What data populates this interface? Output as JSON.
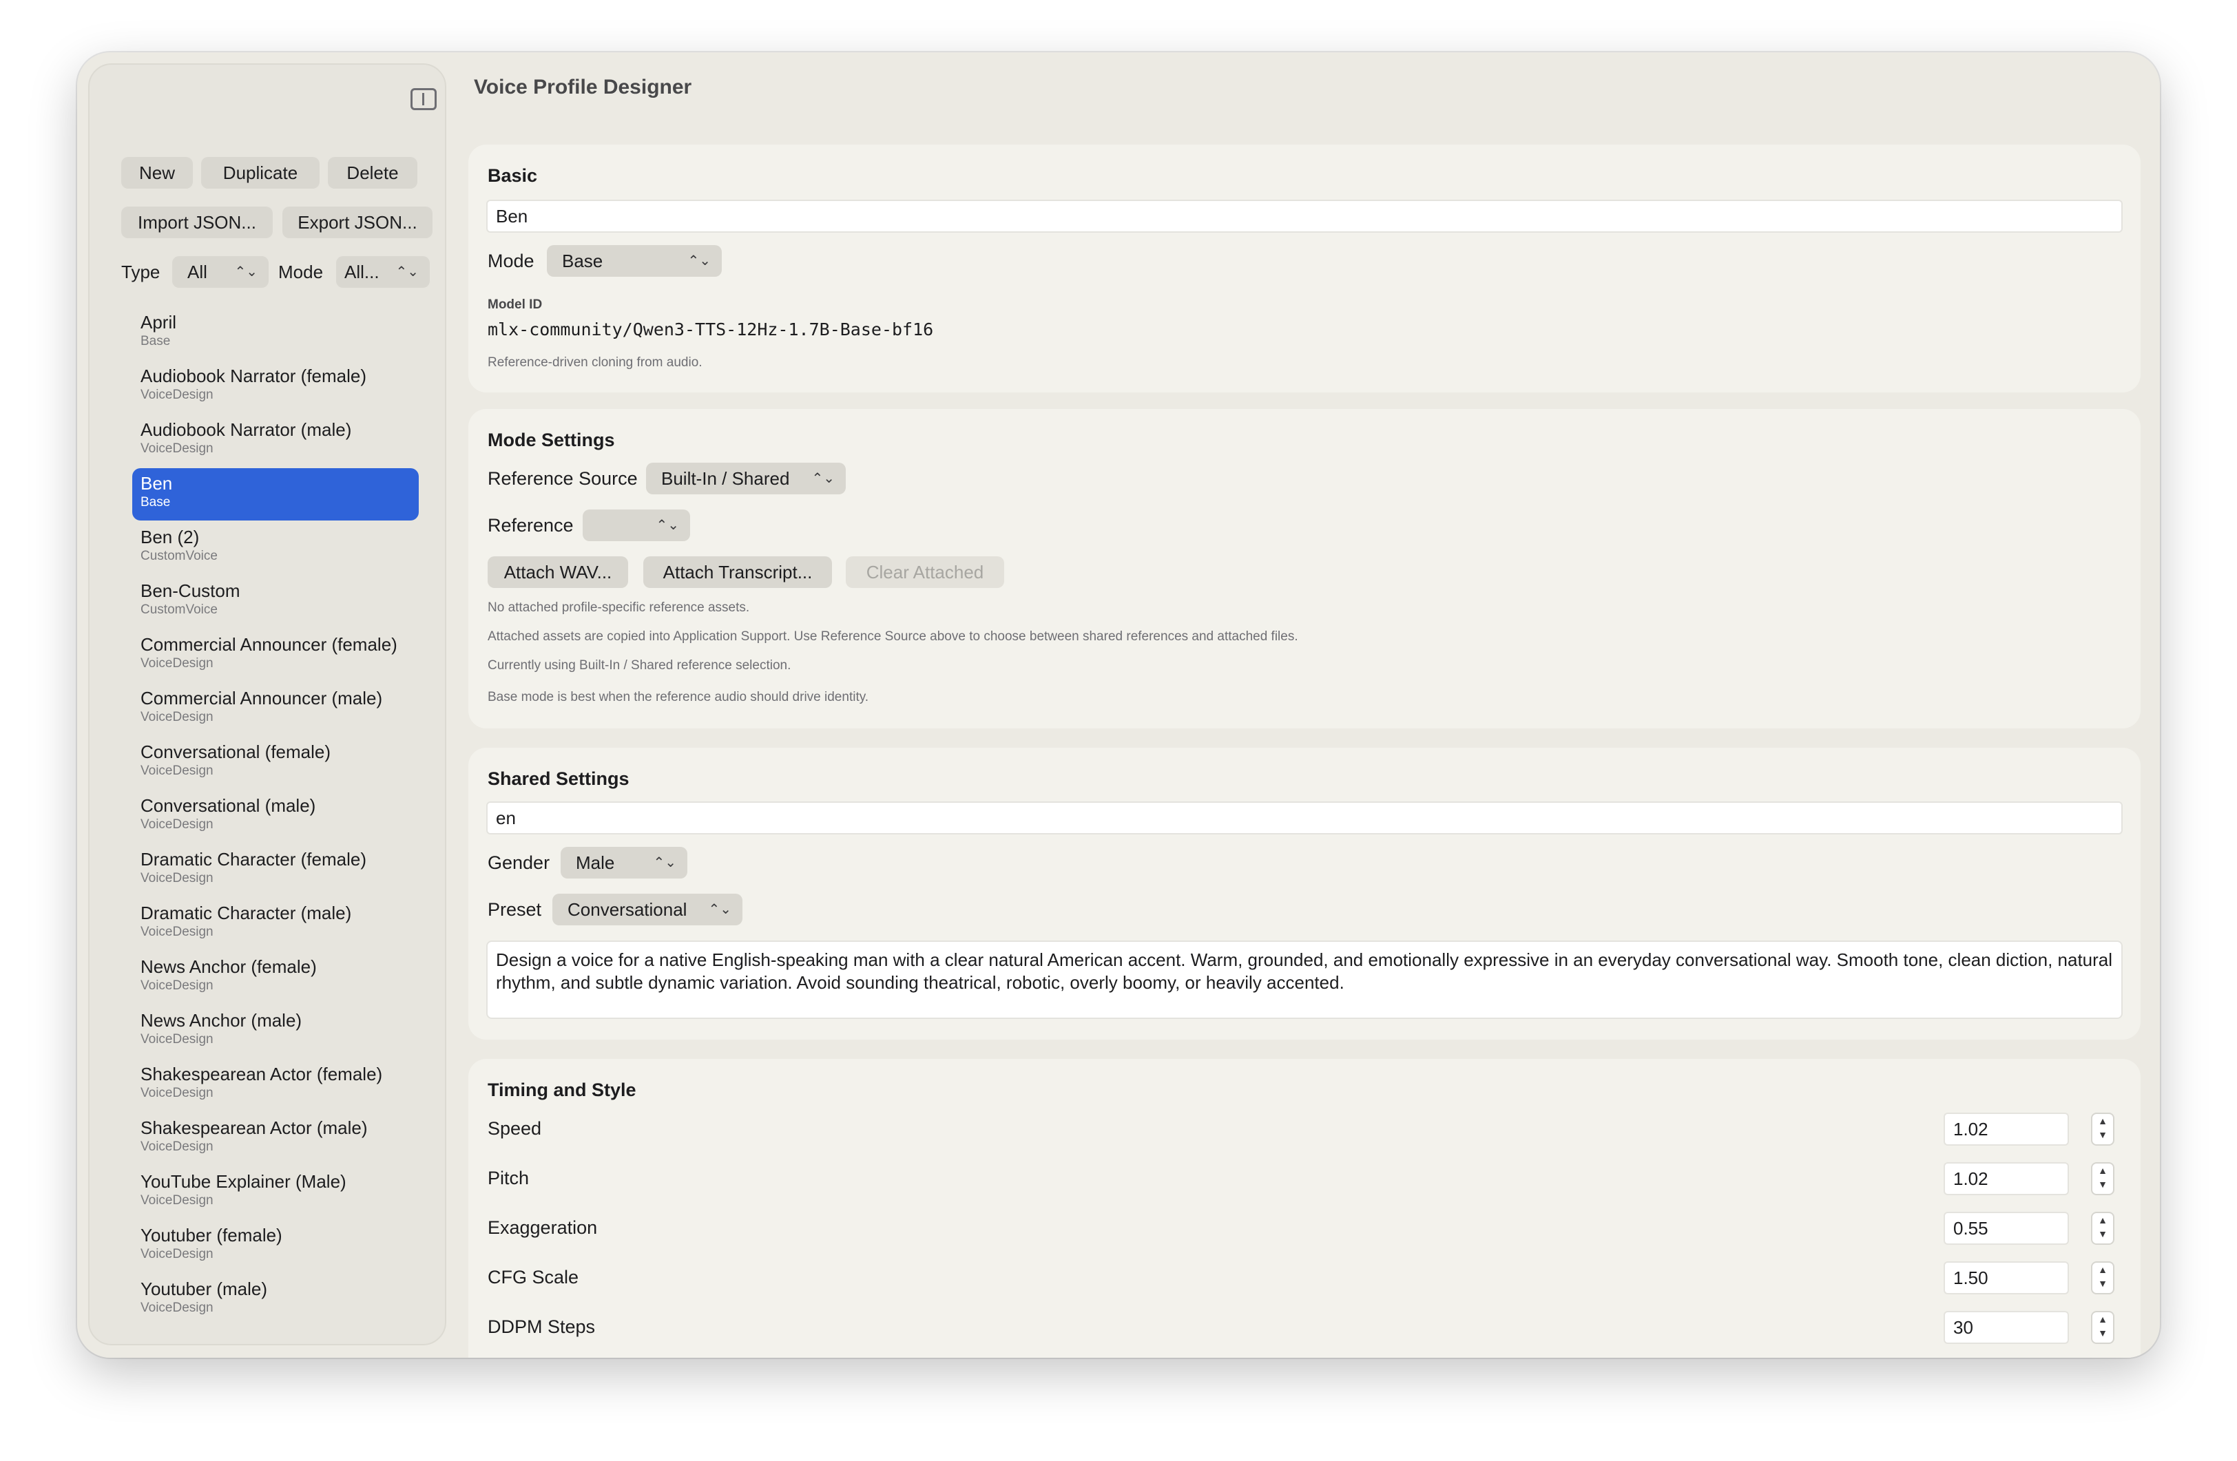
{
  "window": {
    "title": "Voice Profile Designer"
  },
  "sidebar": {
    "buttons": {
      "new": "New",
      "duplicate": "Duplicate",
      "delete": "Delete",
      "import": "Import JSON...",
      "export": "Export JSON..."
    },
    "filters": {
      "type_label": "Type",
      "type_value": "All",
      "mode_label": "Mode",
      "mode_value": "All..."
    },
    "items": [
      {
        "name": "April",
        "sub": "Base"
      },
      {
        "name": "Audiobook Narrator (female)",
        "sub": "VoiceDesign"
      },
      {
        "name": "Audiobook Narrator (male)",
        "sub": "VoiceDesign"
      },
      {
        "name": "Ben",
        "sub": "Base",
        "selected": true
      },
      {
        "name": "Ben (2)",
        "sub": "CustomVoice"
      },
      {
        "name": "Ben-Custom",
        "sub": "CustomVoice"
      },
      {
        "name": "Commercial Announcer (female)",
        "sub": "VoiceDesign"
      },
      {
        "name": "Commercial Announcer (male)",
        "sub": "VoiceDesign"
      },
      {
        "name": "Conversational (female)",
        "sub": "VoiceDesign"
      },
      {
        "name": "Conversational (male)",
        "sub": "VoiceDesign"
      },
      {
        "name": "Dramatic Character (female)",
        "sub": "VoiceDesign"
      },
      {
        "name": "Dramatic Character (male)",
        "sub": "VoiceDesign"
      },
      {
        "name": "News Anchor (female)",
        "sub": "VoiceDesign"
      },
      {
        "name": "News Anchor (male)",
        "sub": "VoiceDesign"
      },
      {
        "name": "Shakespearean Actor (female)",
        "sub": "VoiceDesign"
      },
      {
        "name": "Shakespearean Actor (male)",
        "sub": "VoiceDesign"
      },
      {
        "name": "YouTube Explainer  (Male)",
        "sub": "VoiceDesign"
      },
      {
        "name": "Youtuber (female)",
        "sub": "VoiceDesign"
      },
      {
        "name": "Youtuber (male)",
        "sub": "VoiceDesign"
      }
    ]
  },
  "basic": {
    "title": "Basic",
    "name_value": "Ben",
    "mode_label": "Mode",
    "mode_value": "Base",
    "model_id_label": "Model ID",
    "model_id": "mlx-community/Qwen3-TTS-12Hz-1.7B-Base-bf16",
    "note": "Reference-driven cloning from audio."
  },
  "mode_settings": {
    "title": "Mode Settings",
    "reference_source_label": "Reference Source",
    "reference_source_value": "Built-In / Shared",
    "reference_label": "Reference",
    "reference_value": "",
    "attach_wav": "Attach WAV...",
    "attach_transcript": "Attach Transcript...",
    "clear_attached": "Clear Attached",
    "notes": [
      "No attached profile-specific reference assets.",
      "Attached assets are copied into Application Support. Use Reference Source above to choose between shared references and attached files.",
      "Currently using Built-In / Shared reference selection.",
      "Base mode is best when the reference audio should drive identity."
    ]
  },
  "shared_settings": {
    "title": "Shared Settings",
    "language_value": "en",
    "gender_label": "Gender",
    "gender_value": "Male",
    "preset_label": "Preset",
    "preset_value": "Conversational",
    "description": "Design a voice for a native English-speaking man with a clear natural American accent. Warm, grounded, and emotionally expressive in an everyday conversational way. Smooth tone, clean diction, natural rhythm, and subtle dynamic variation. Avoid sounding theatrical, robotic, overly boomy, or heavily accented."
  },
  "timing": {
    "title": "Timing and Style",
    "rows": [
      {
        "label": "Speed",
        "value": "1.02"
      },
      {
        "label": "Pitch",
        "value": "1.02"
      },
      {
        "label": "Exaggeration",
        "value": "0.55"
      },
      {
        "label": "CFG Scale",
        "value": "1.50"
      },
      {
        "label": "DDPM Steps",
        "value": "30"
      }
    ]
  },
  "icons": {
    "toggle": "sidebar-toggle-icon",
    "chevron": "chevron-up-down-icon",
    "stepper": "stepper-icon"
  }
}
